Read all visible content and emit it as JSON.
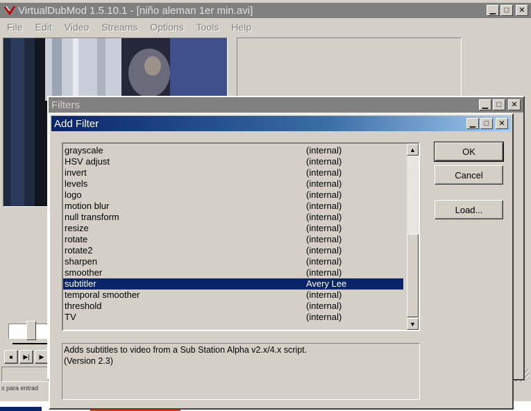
{
  "main_window": {
    "title": "VirtualDubMod 1.5.10.1 - [niño aleman 1er min.avi]",
    "menu": [
      "File",
      "Edit",
      "Video",
      "Streams",
      "Options",
      "Tools",
      "Help"
    ],
    "status_text": "s para entrad"
  },
  "filters_window": {
    "title": "Filters"
  },
  "add_filter_dialog": {
    "title": "Add Filter",
    "filters": [
      {
        "name": "grayscale",
        "author": "(internal)"
      },
      {
        "name": "HSV adjust",
        "author": "(internal)"
      },
      {
        "name": "invert",
        "author": "(internal)"
      },
      {
        "name": "levels",
        "author": "(internal)"
      },
      {
        "name": "logo",
        "author": "(internal)"
      },
      {
        "name": "motion blur",
        "author": "(internal)"
      },
      {
        "name": "null transform",
        "author": "(internal)"
      },
      {
        "name": "resize",
        "author": "(internal)"
      },
      {
        "name": "rotate",
        "author": "(internal)"
      },
      {
        "name": "rotate2",
        "author": "(internal)"
      },
      {
        "name": "sharpen",
        "author": "(internal)"
      },
      {
        "name": "smoother",
        "author": "(internal)"
      },
      {
        "name": "subtitler",
        "author": "Avery Lee",
        "selected": true
      },
      {
        "name": "temporal smoother",
        "author": "(internal)"
      },
      {
        "name": "threshold",
        "author": "(internal)"
      },
      {
        "name": "TV",
        "author": "(internal)"
      }
    ],
    "buttons": {
      "ok": "OK",
      "cancel": "Cancel",
      "load": "Load..."
    },
    "description_line1": "Adds subtitles to video from a Sub Station Alpha v2.x/4.x script.",
    "description_line2": "(Version 2.3)"
  },
  "icons": {
    "app": "virtualdub-icon",
    "minimize": "minimize-icon",
    "maximize": "maximize-icon",
    "close": "close-icon"
  },
  "colors": {
    "selection": "#0a246a",
    "face": "#d4d0c8",
    "inactive_title": "#808080"
  }
}
